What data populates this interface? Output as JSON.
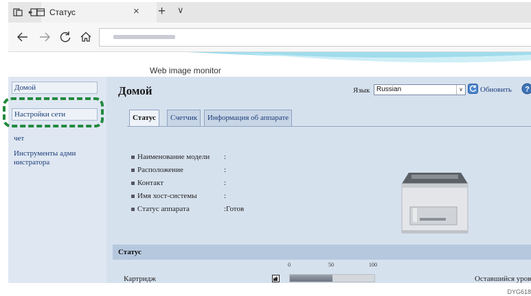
{
  "browser": {
    "tab_title": "Статус",
    "tab_close": "×",
    "tab_new": "+",
    "tab_menu": "∨"
  },
  "header": {
    "title": "Web image monitor"
  },
  "sidebar": {
    "items": [
      {
        "label": "Домой"
      },
      {
        "label": "Настройки сети"
      },
      {
        "label": "чет"
      },
      {
        "label": "Инструменты адми"
      },
      {
        "label": "нистратора"
      }
    ]
  },
  "main": {
    "title": "Домой",
    "language_label": "Язык",
    "language_value": "Russian",
    "refresh_label": "Обновить",
    "tabs": [
      {
        "label": "Статус"
      },
      {
        "label": "Счетчик"
      },
      {
        "label": "Информация об аппарате"
      }
    ],
    "info": [
      {
        "label": "Наименование модели",
        "value": ":"
      },
      {
        "label": "Расположение",
        "value": ":"
      },
      {
        "label": "Контакт",
        "value": ":"
      },
      {
        "label": "Имя хост-системы",
        "value": ":"
      },
      {
        "label": "Статус аппарата",
        "value": ":Готов"
      }
    ],
    "status_section": {
      "title": "Статус",
      "scale": [
        "0",
        "50",
        "100"
      ],
      "cartridge_label": "Картридж",
      "cartridge_level": 50,
      "remaining_label": "Оставшийся уровен"
    }
  },
  "figure_id": "DYG618",
  "colors": {
    "highlight": "#218a3c",
    "sidebar_bg": "#dfe7f2",
    "content_bg": "#d6e1ee"
  }
}
